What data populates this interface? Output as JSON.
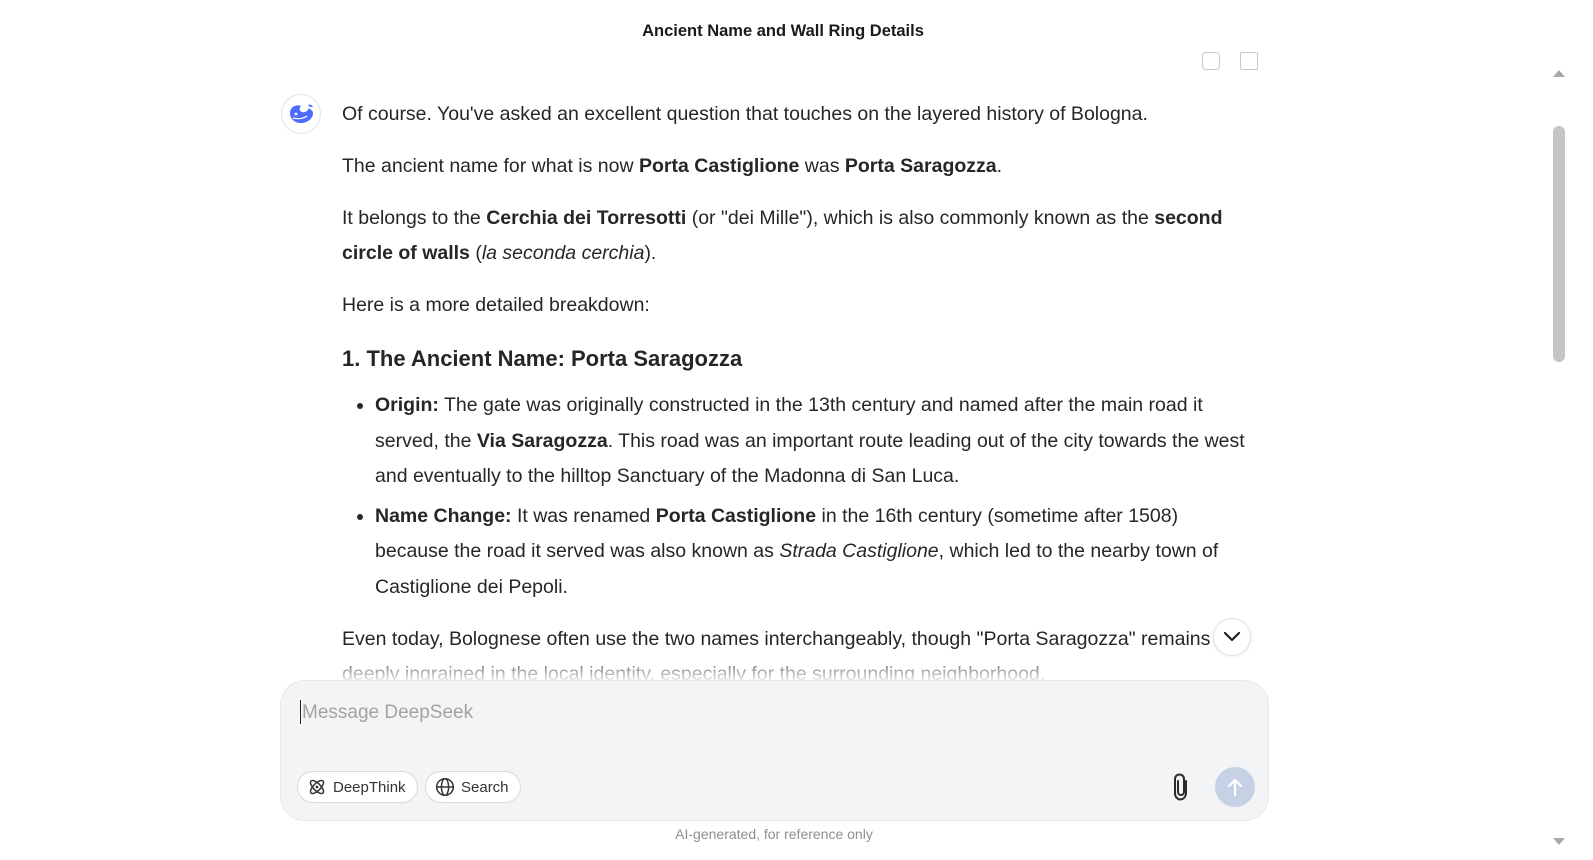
{
  "header": {
    "title": "Ancient Name and Wall Ring Details"
  },
  "message": {
    "p1": "Of course. You've asked an excellent question that touches on the layered history of Bologna.",
    "p2": {
      "a": "The ancient name for what is now ",
      "b": "Porta Castiglione",
      "c": " was ",
      "d": "Porta Saragozza",
      "e": "."
    },
    "p3": {
      "a": "It belongs to the ",
      "b": "Cerchia dei Torresotti",
      "c": " (or \"dei Mille\"), which is also commonly known as the ",
      "d": "second circle of walls",
      "e": " (",
      "f": "la seconda cerchia",
      "g": ")."
    },
    "p4": "Here is a more detailed breakdown:",
    "heading1": "1. The Ancient Name: Porta Saragozza",
    "bullets": [
      {
        "label": "Origin:",
        "a": " The gate was originally constructed in the 13th century and named after the main road it served, the ",
        "b": "Via Saragozza",
        "c": ". This road was an important route leading out of the city towards the west and eventually to the hilltop Sanctuary of the Madonna di San Luca."
      },
      {
        "label": "Name Change:",
        "a": " It was renamed ",
        "b": "Porta Castiglione",
        "c": " in the 16th century (sometime after 1508) because the road it served was also known as ",
        "d": "Strada Castiglione",
        "e": ", which led to the nearby town of Castiglione dei Pepoli."
      }
    ],
    "p5": "Even today, Bolognese often use the two names interchangeably, though \"Porta Saragozza\" remains deeply ingrained in the local identity, especially for the surrounding neighborhood."
  },
  "composer": {
    "placeholder": "Message DeepSeek",
    "deepthink_label": "DeepThink",
    "search_label": "Search"
  },
  "footer": {
    "note": "AI-generated, for reference only"
  },
  "colors": {
    "brand": "#4d6bfe",
    "send_disabled": "#c6d1e6"
  },
  "icons": [
    "deepseek-whale-icon",
    "chevron-down-icon",
    "atom-icon",
    "globe-icon",
    "paperclip-icon",
    "arrow-up-icon"
  ]
}
